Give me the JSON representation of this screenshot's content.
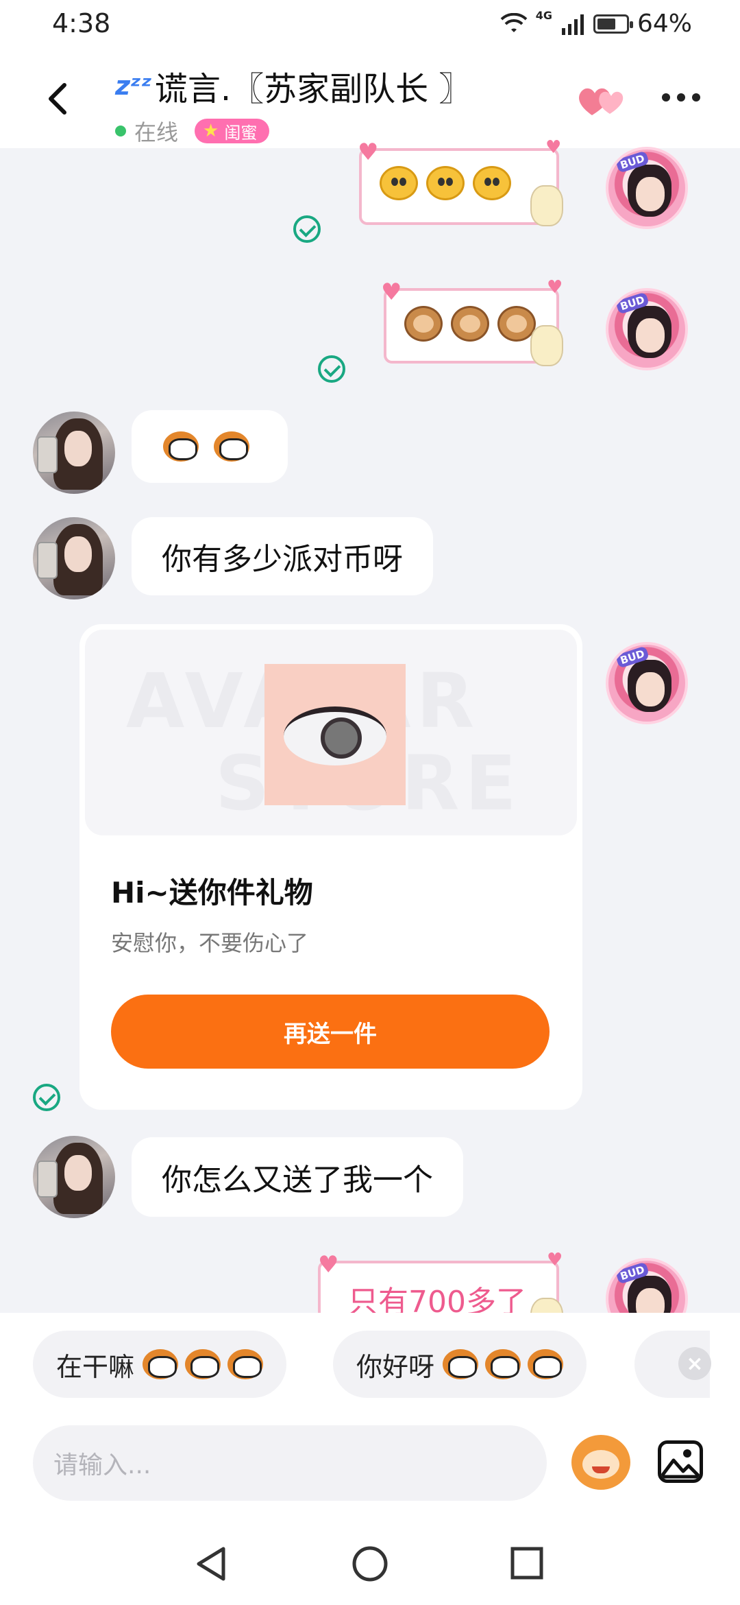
{
  "status_bar": {
    "time": "4:38",
    "network": "4G",
    "battery": "64%",
    "battery_level": 0.64
  },
  "header": {
    "title": "谎言.〖苏家副队长 〗",
    "title_prefix": "zᶻᶻ",
    "status": "在线",
    "relation_badge": "闺蜜"
  },
  "messages": [
    {
      "from": "me",
      "type": "sticker",
      "sticker": "chick-faces"
    },
    {
      "from": "me",
      "type": "sticker",
      "sticker": "monkey-faces"
    },
    {
      "from": "other",
      "type": "emoji",
      "emoji": "grin-face x2"
    },
    {
      "from": "other",
      "type": "text",
      "text": "你有多少派对币呀"
    },
    {
      "from": "me",
      "type": "gift",
      "title": "Hi~送你件礼物",
      "subtitle": "安慰你，不要伤心了",
      "button": "再送一件"
    },
    {
      "from": "other",
      "type": "text",
      "text": "你怎么又送了我一个"
    },
    {
      "from": "me",
      "type": "sticker-text",
      "text": "只有700多了"
    }
  ],
  "quick_replies": [
    {
      "label": "在干嘛"
    },
    {
      "label": "你好呀"
    }
  ],
  "input": {
    "placeholder": "请输入..."
  },
  "colors": {
    "accent_orange": "#fb7012",
    "check_green": "#19a882",
    "badge_pink": "#ff6fb0",
    "online_green": "#39c36b"
  }
}
